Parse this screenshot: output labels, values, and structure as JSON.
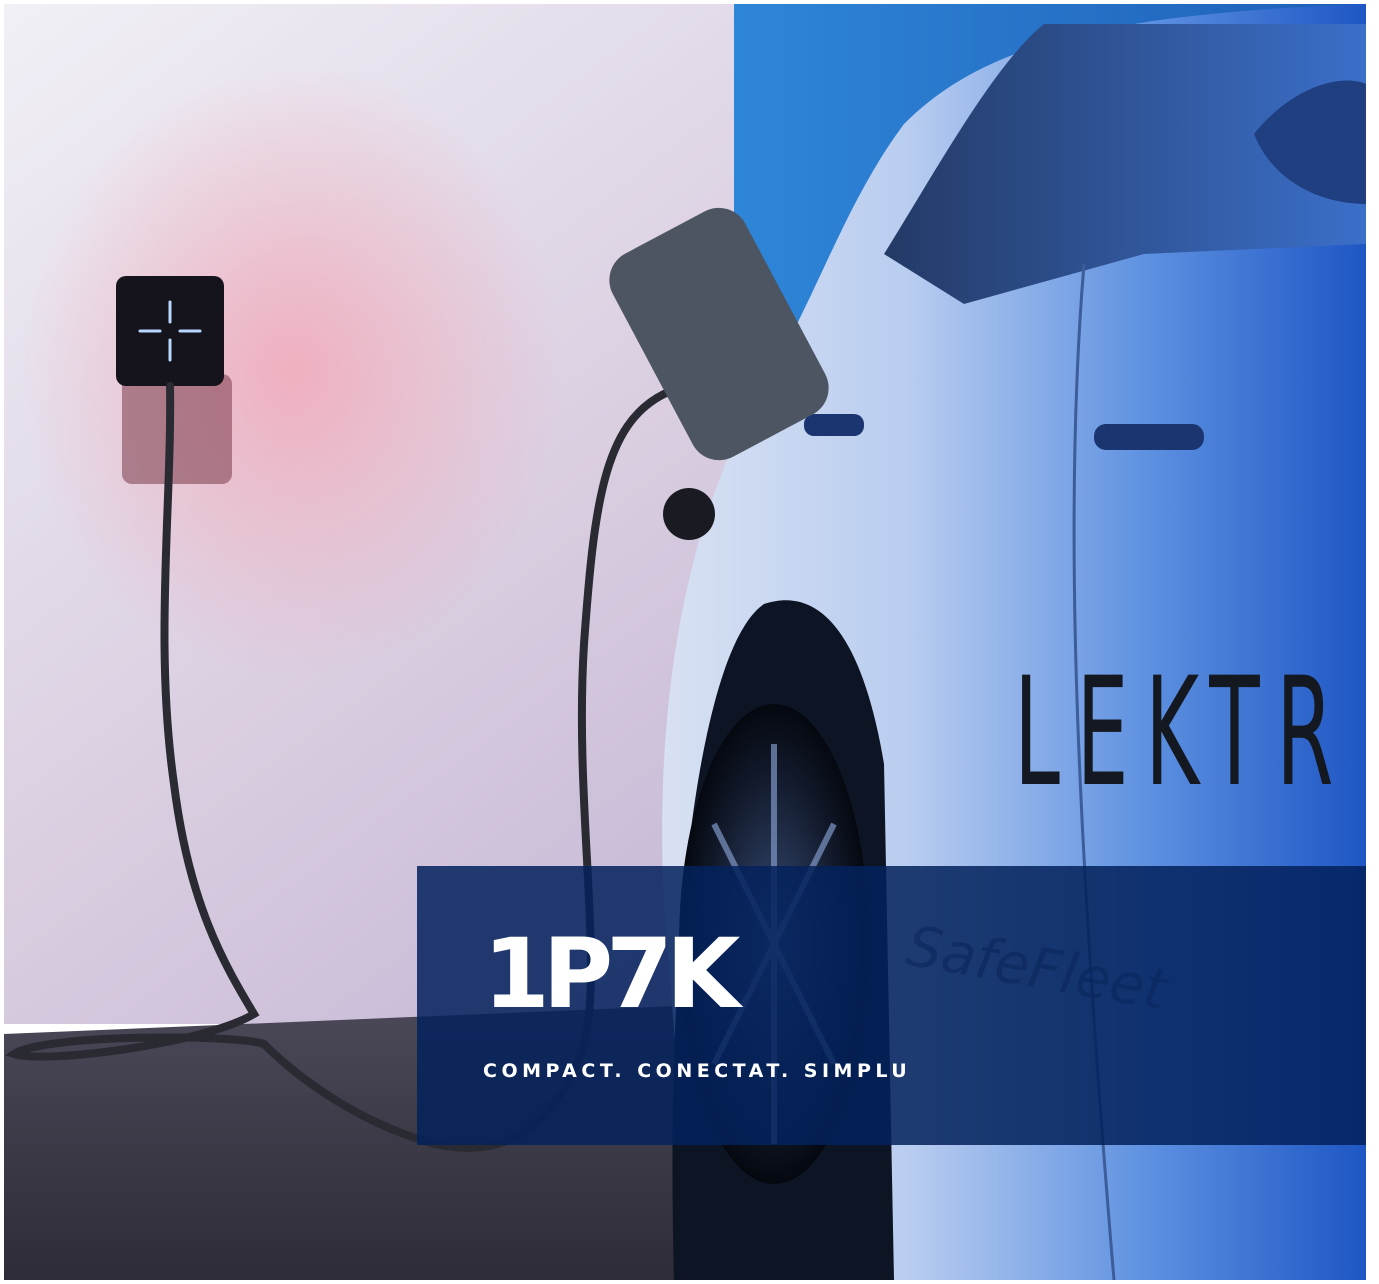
{
  "overlay": {
    "product_name": "1P7K",
    "tagline": "COMPACT. CONECTAT. SIMPLU"
  },
  "photo": {
    "car_lettering": "LEKTR",
    "car_decal": "SafeFleet"
  },
  "colors": {
    "panel": "#03225c",
    "wall_light": "#e9e4f0",
    "wall_pink": "#e6a2b9",
    "wall_blue": "#1d6fc9",
    "charger_led": "#b8d8ff",
    "floor": "#3f3c4a"
  }
}
